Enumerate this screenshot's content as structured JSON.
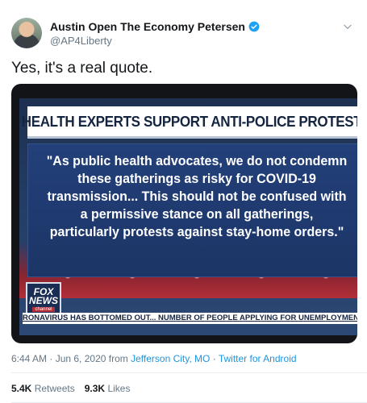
{
  "author": {
    "display_name": "Austin Open The Economy Petersen",
    "handle": "@AP4Liberty",
    "verified": true,
    "avatar_icon": "user-avatar"
  },
  "tweet": {
    "text": "Yes, it's a real quote."
  },
  "media": {
    "headline": "HEALTH EXPERTS SUPPORT ANTI-POLICE PROTESTS",
    "quote": "\"As public health advocates, we do not condemn these gatherings as risky for COVID-19 transmission... This should not be confused with a permissive stance on all gatherings, particularly protests against stay-home orders.\"",
    "logo_lines": [
      "FOX",
      "NEWS",
      "channel"
    ],
    "ticker": "RONAVIRUS HAS BOTTOMED OUT... NUMBER OF PEOPLE APPLYING FOR UNEMPLOYMENT BENEFITS HAS"
  },
  "meta": {
    "timestamp": "6:44 AM · Jun 6, 2020",
    "from_label": "from",
    "location": "Jefferson City, MO",
    "separator": "·",
    "source": "Twitter for Android"
  },
  "stats": {
    "retweets_count": "5.4K",
    "retweets_label": "Retweets",
    "likes_count": "9.3K",
    "likes_label": "Likes"
  },
  "colors": {
    "link": "#1b95e0",
    "verified": "#1da1f2",
    "muted": "#657786"
  }
}
